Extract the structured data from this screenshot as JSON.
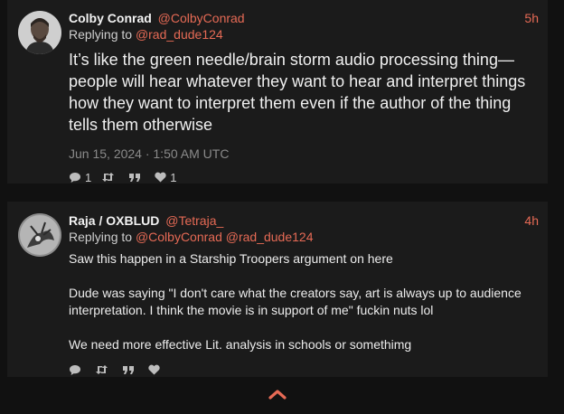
{
  "colors": {
    "accent": "#e66a55",
    "card": "#1b1b1b",
    "page": "#111111"
  },
  "posts": [
    {
      "author": {
        "name": "Colby Conrad",
        "handle": "@ColbyConrad"
      },
      "time": "5h",
      "replying_label": "Replying to",
      "replying_to": [
        "@rad_dude124"
      ],
      "paragraphs": [
        "It’s like the green needle/brain storm audio processing thing—people will hear whatever they want to hear and interpret things how they want to interpret them even if the author of the thing tells them otherwise"
      ],
      "date": "Jun 15, 2024 · 1:50 AM UTC",
      "stats": {
        "replies": "1",
        "reposts": "",
        "quotes": "",
        "likes": "1"
      }
    },
    {
      "author": {
        "name": "Raja / OXBLUD",
        "handle": "@Tetraja_"
      },
      "time": "4h",
      "replying_label": "Replying to",
      "replying_to": [
        "@ColbyConrad",
        "@rad_dude124"
      ],
      "paragraphs": [
        "Saw this happen in a Starship Troopers argument on here",
        "Dude was saying \"I don't care what the creators say, art is always up to audience interpretation. I think the movie is in support of me\" fuckin nuts lol",
        "We need more effective Lit. analysis in schools or somethimg"
      ],
      "stats": {
        "replies": "",
        "reposts": "",
        "quotes": "",
        "likes": ""
      }
    }
  ],
  "icons": {
    "reply": "comment-icon",
    "repost": "retweet-icon",
    "quote": "quote-icon",
    "like": "heart-icon",
    "scroll": "chevron-up-icon"
  }
}
